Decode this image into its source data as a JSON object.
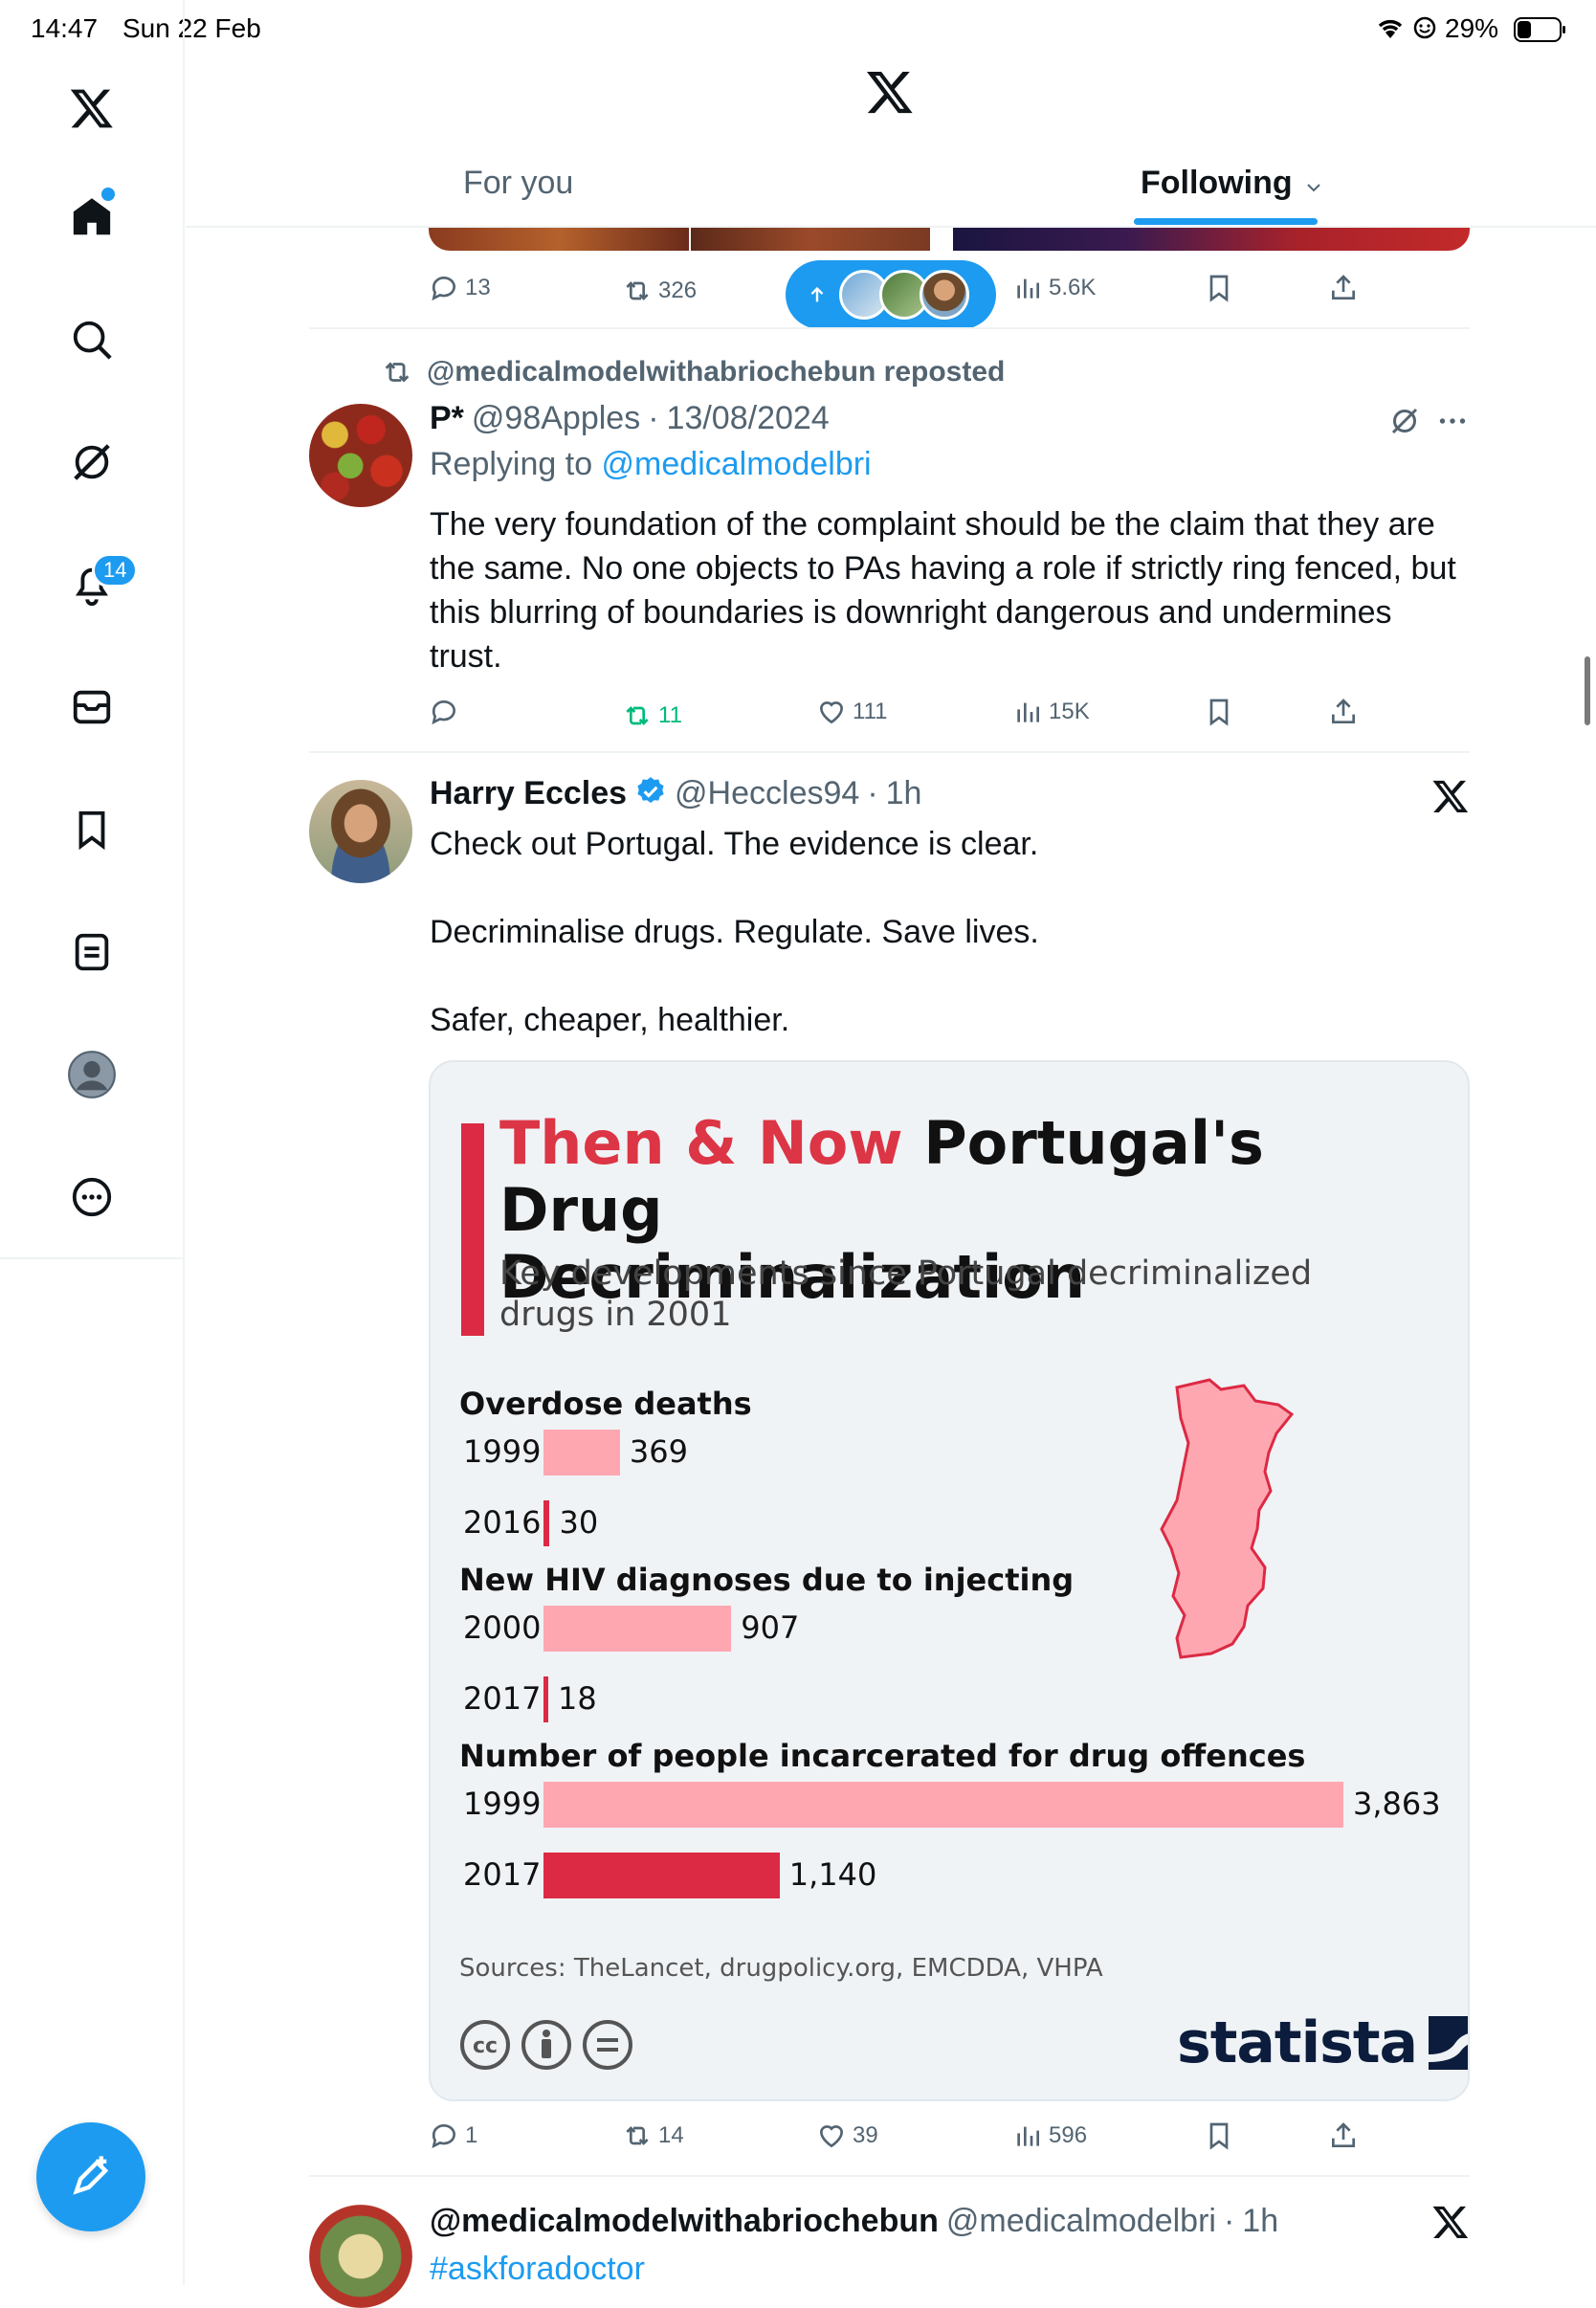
{
  "status_bar": {
    "time": "14:47",
    "date": "Sun 22 Feb",
    "battery": "29%"
  },
  "nav": {
    "notifications_badge": "14"
  },
  "header": {
    "tab_for_you": "For you",
    "tab_following": "Following"
  },
  "prev_tweet_actions": {
    "replies": "13",
    "reposts": "326",
    "views": "5.6K"
  },
  "tweet_1": {
    "repost_label": "@medicalmodelwithabriochebun reposted",
    "name": "P*",
    "handle": "@98Apples",
    "sep": "·",
    "date": "13/08/2024",
    "reply_prefix": "Replying to ",
    "reply_to": "@medicalmodelbri",
    "text": "The very foundation of the complaint should be the claim that they are the same. No one objects to PAs having a role if strictly ring fenced, but this blurring of boundaries is downright dangerous and undermines trust.",
    "reposts": "11",
    "likes": "111",
    "views": "15K"
  },
  "tweet_2": {
    "name": "Harry Eccles",
    "handle": "@Heccles94",
    "sep": "·",
    "time": "1h",
    "line1": "Check out Portugal. The evidence is clear.",
    "line2": "Decriminalise drugs. Regulate. Save lives.",
    "line3": "Safer, cheaper, healthier.",
    "replies": "1",
    "reposts": "14",
    "likes": "39",
    "views": "596"
  },
  "infographic": {
    "title_red": "Then & Now",
    "title_black_1": "Portugal's Drug",
    "title_black_2": "Decriminalization",
    "subtitle_1": "Key developments since Portugal decriminalized",
    "subtitle_2": "drugs in 2001",
    "sources": "Sources: TheLancet, drugpolicy.org, EMCDDA, VHPA",
    "brand": "statista",
    "license_icons": [
      "cc",
      "by",
      "nd"
    ]
  },
  "chart_data": {
    "type": "bar",
    "title": "Then & Now Portugal's Drug Decriminalization",
    "subtitle": "Key developments since Portugal decriminalized drugs in 2001",
    "groups": [
      {
        "name": "Overdose deaths",
        "categories": [
          "1999",
          "2016"
        ],
        "values": [
          369,
          30
        ],
        "labels": [
          "369",
          "30"
        ]
      },
      {
        "name": "New HIV diagnoses due to injecting",
        "categories": [
          "2000",
          "2017"
        ],
        "values": [
          907,
          18
        ],
        "labels": [
          "907",
          "18"
        ]
      },
      {
        "name": "Number of people incarcerated for drug offences",
        "categories": [
          "1999",
          "2017"
        ],
        "values": [
          3863,
          1140
        ],
        "labels": [
          "3,863",
          "1,140"
        ]
      }
    ],
    "colors": {
      "then": "#ffa7b1",
      "now": "#dc2a44"
    }
  },
  "tweet_3": {
    "name": "@medicalmodelwithabriochebun",
    "handle": "@medicalmodelbri",
    "sep": "·",
    "time": "1h",
    "hashtag": "#askforadoctor"
  },
  "colors": {
    "accent": "#1d9bf0",
    "repost_green": "#00ba7c",
    "text": "#0f1419",
    "muted": "#536471"
  }
}
